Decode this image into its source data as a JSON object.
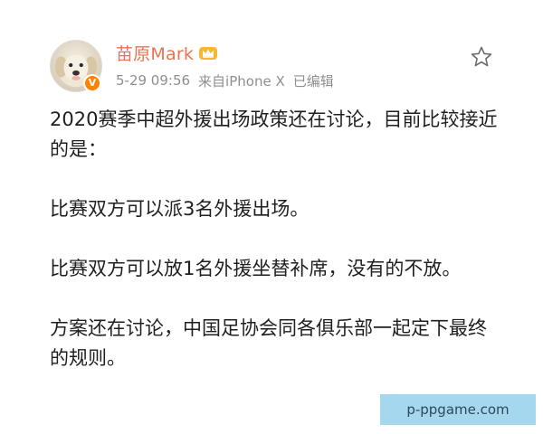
{
  "post": {
    "author": {
      "name": "苗原Mark",
      "verified_mark": "V"
    },
    "meta": {
      "time": "5-29 09:56",
      "source": "来自iPhone X",
      "edited": "已编辑"
    },
    "icons": {
      "favorite": "star-outline-icon",
      "member": "crown-icon",
      "accent": "#eb7350"
    },
    "paragraphs": [
      "2020赛季中超外援出场政策还在讨论，目前比较接近的是：",
      "比赛双方可以派3名外援出场。",
      "比赛双方可以放1名外援坐替补席，没有的不放。",
      "方案还在讨论，中国足协会同各俱乐部一起定下最终的规则。"
    ]
  },
  "watermark": {
    "text": "p-ppgame.com"
  }
}
